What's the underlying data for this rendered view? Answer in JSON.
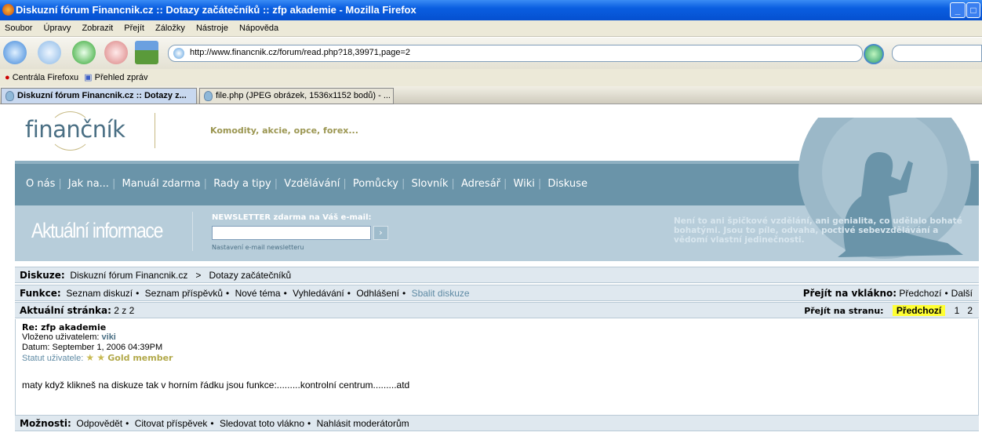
{
  "window": {
    "title": "Diskuzní fórum Financnik.cz :: Dotazy začátečníků :: zfp akademie - Mozilla Firefox"
  },
  "menu": [
    "Soubor",
    "Úpravy",
    "Zobrazit",
    "Přejít",
    "Záložky",
    "Nástroje",
    "Nápověda"
  ],
  "url": "http://www.financnik.cz/forum/read.php?18,39971,page=2",
  "bookmarks": [
    "Centrála Firefoxu",
    "Přehled zpráv"
  ],
  "tabs": [
    "Diskuzní fórum Financnik.cz :: Dotazy z...",
    "file.php (JPEG obrázek, 1536x1152 bodů) - ..."
  ],
  "site": {
    "logo": "finančník",
    "slogan": "Komodity, akcie, opce, forex...",
    "nav": [
      "O nás",
      "Jak na...",
      "Manuál zdarma",
      "Rady a tipy",
      "Vzdělávání",
      "Pomůcky",
      "Slovník",
      "Adresář",
      "Wiki",
      "Diskuse"
    ],
    "info_title": "Aktuální informace",
    "newsletter_label": "NEWSLETTER zdarma na Váš e-mail:",
    "newsletter_go": "›",
    "newsletter_settings": "Nastavení e-mail newsletteru",
    "quote": "Není to ani špičkové vzdělání, ani genialita, co udělalo bohaté bohatými. Jsou to píle, odvaha, poctivé sebevzdělávání a vědomí vlastní jedinečnosti."
  },
  "forum": {
    "diskuze_label": "Diskuze:",
    "crumb1": "Diskuzní fórum Financnik.cz",
    "crumb_sep": ">",
    "crumb2": "Dotazy začátečníků",
    "funkce_label": "Funkce:",
    "funkce": [
      "Seznam diskuzí",
      "Seznam příspěvků",
      "Nové téma",
      "Vyhledávání",
      "Odhlášení",
      "Sbalit diskuze"
    ],
    "thread_label": "Přejít na vklákno:",
    "thread_prev": "Předchozí",
    "thread_next": "Další",
    "page_label": "Aktuální stránka:",
    "page_value": "2 z 2",
    "goto_label": "Přejít na stranu:",
    "goto_prev": "Předchozí",
    "pages": [
      "1",
      "2"
    ],
    "post": {
      "title": "Re: zfp akademie",
      "author_label": "Vloženo uživatelem:",
      "author": "viki",
      "date": "Datum: September 1, 2006 04:39PM",
      "status_label": "Statut uživatele:",
      "stars": "★ ★",
      "status": "Gold member",
      "body": "maty když klikneš na diskuze tak v horním řádku jsou funkce:.........kontrolní centrum.........atd"
    },
    "options_label": "Možnosti:",
    "options": [
      "Odpovědět",
      "Citovat příspěvek",
      "Sledovat toto vlákno",
      "Nahlásit moderátorům"
    ]
  }
}
